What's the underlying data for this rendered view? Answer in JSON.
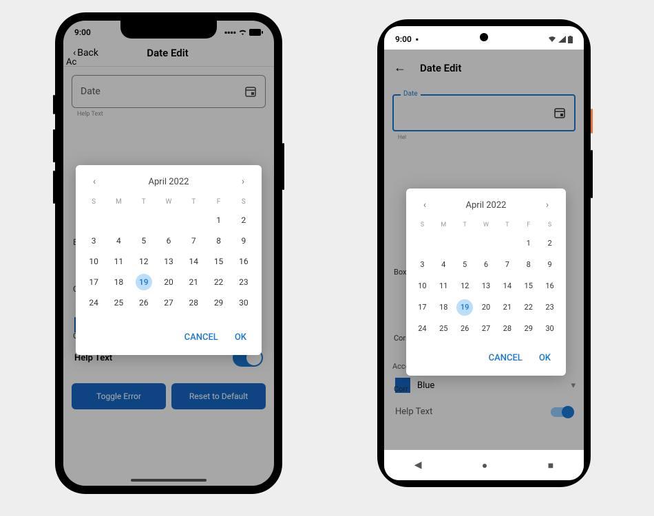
{
  "status": {
    "time": "9:00"
  },
  "header": {
    "back": "Back",
    "title": "Date Edit"
  },
  "dateField": {
    "label": "Date",
    "helpText": "Help Text"
  },
  "picker": {
    "monthYear": "April 2022",
    "dow": [
      "S",
      "M",
      "T",
      "W",
      "T",
      "F",
      "S"
    ],
    "leadingBlanks": 5,
    "daysInMonth": 30,
    "selectedDay": 19,
    "cancel": "CANCEL",
    "ok": "OK"
  },
  "accent": {
    "labelIos": "Ac",
    "labelAndroid": "Accent Color",
    "value": "Blue"
  },
  "helpToggle": {
    "label": "Help Text",
    "on": true
  },
  "buttons": {
    "toggle": "Toggle Error",
    "reset": "Reset to Default"
  },
  "clipLabels": {
    "b": "B",
    "c1": "C",
    "c2": "C",
    "box": "Box",
    "corn": "Corn",
    "corr": "Corr"
  },
  "androidNav": {
    "back": "◀",
    "home": "●",
    "recent": "■"
  }
}
